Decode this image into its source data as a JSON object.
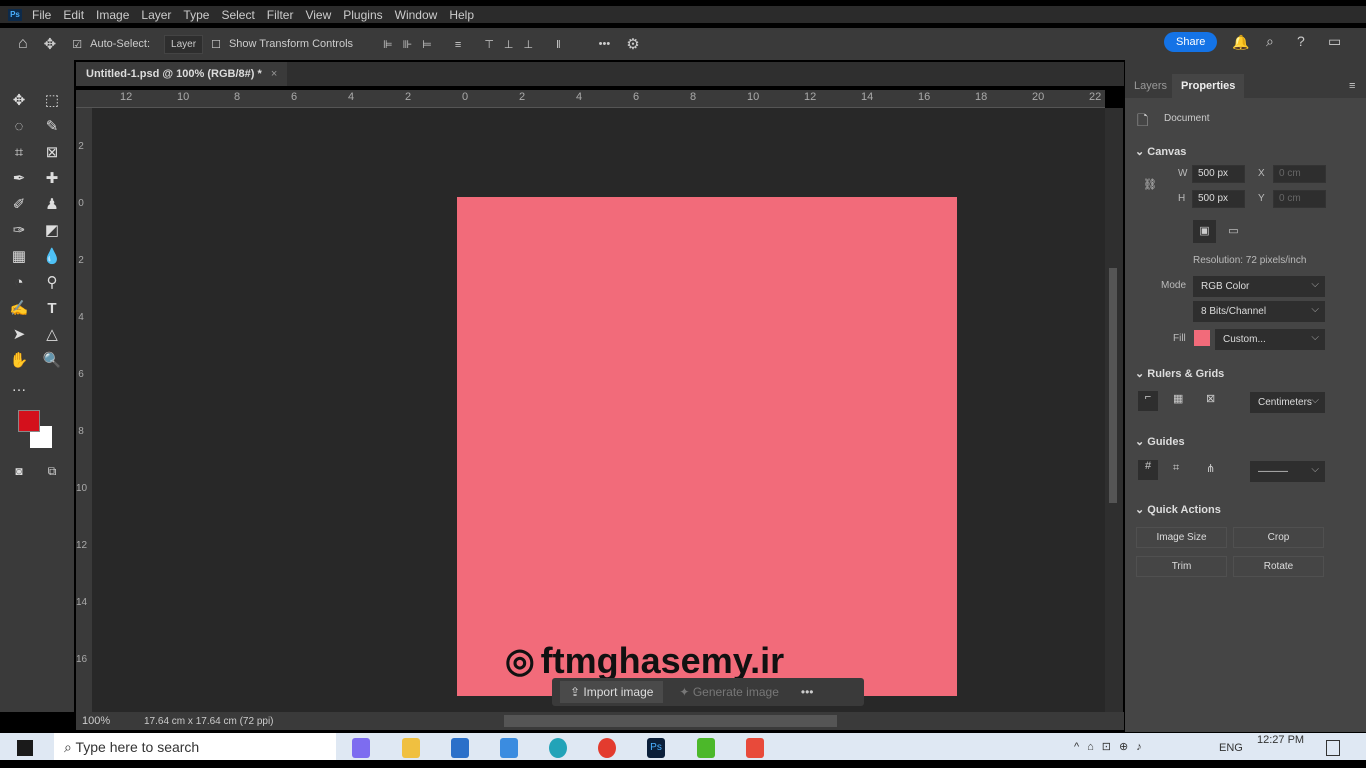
{
  "menu": {
    "items": [
      "File",
      "Edit",
      "Image",
      "Layer",
      "Type",
      "Select",
      "Filter",
      "View",
      "Plugins",
      "Window",
      "Help"
    ]
  },
  "options": {
    "auto_select": "Auto-Select:",
    "layer": "Layer",
    "transform": "Show Transform Controls",
    "share": "Share"
  },
  "tab": {
    "title": "Untitled-1.psd @ 100% (RGB/8#) *"
  },
  "ruler": {
    "h": [
      "12",
      "10",
      "8",
      "6",
      "4",
      "2",
      "0",
      "2",
      "4",
      "6",
      "8",
      "10",
      "12",
      "14",
      "16",
      "18",
      "20",
      "22"
    ],
    "v": [
      "2",
      "0",
      "2",
      "4",
      "6",
      "8",
      "10",
      "12",
      "14",
      "16"
    ]
  },
  "document": {
    "fill": "#f26b7a",
    "watermark": "ftmghasemy.ir"
  },
  "context_bar": {
    "import": "Import image",
    "generate": "Generate image",
    "more": "•••"
  },
  "status": {
    "zoom": "100%",
    "size": "17.64 cm x 17.64 cm (72 ppi)"
  },
  "panel": {
    "tabs": [
      "Layers",
      "Properties"
    ],
    "document": "Document",
    "canvas": "Canvas",
    "w_label": "W",
    "w": "500 px",
    "h_label": "H",
    "h": "500 px",
    "x_label": "X",
    "x": "0 cm",
    "y_label": "Y",
    "y": "0 cm",
    "resolution": "Resolution: 72 pixels/inch",
    "mode_label": "Mode",
    "mode": "RGB Color",
    "bits": "8 Bits/Channel",
    "fill_label": "Fill",
    "fill": "Custom...",
    "rulers": "Rulers & Grids",
    "units": "Centimeters",
    "guides": "Guides",
    "quick": "Quick Actions",
    "actions": [
      "Image Size",
      "Crop",
      "Trim",
      "Rotate"
    ]
  },
  "taskbar": {
    "search": "Type here to search",
    "time": "12:27 PM",
    "lang": "ENG"
  }
}
